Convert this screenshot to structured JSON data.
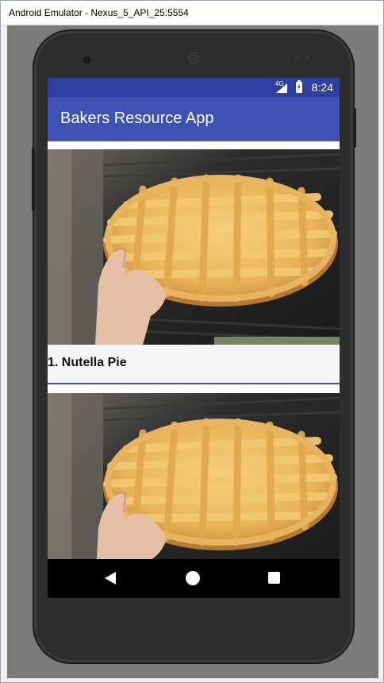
{
  "window": {
    "title": "Android Emulator - Nexus_5_API_25:5554"
  },
  "status_bar": {
    "network": "4G",
    "time": "8:24",
    "signal_icon": "cellular-signal-icon",
    "battery_icon": "battery-charging-icon"
  },
  "app_bar": {
    "title": "Bakers Resource App"
  },
  "recipes": [
    {
      "title": "1. Nutella Pie",
      "image": "lattice-pie-image"
    },
    {
      "title": "",
      "image": "lattice-pie-image"
    }
  ],
  "nav_bar": {
    "back_icon": "back-icon",
    "home_icon": "home-icon",
    "recents_icon": "recents-icon"
  },
  "colors": {
    "status_bar": "#303f9f",
    "app_bar": "#3f51b5",
    "accent_divider": "#3f51b5",
    "nav_bar": "#000000"
  }
}
